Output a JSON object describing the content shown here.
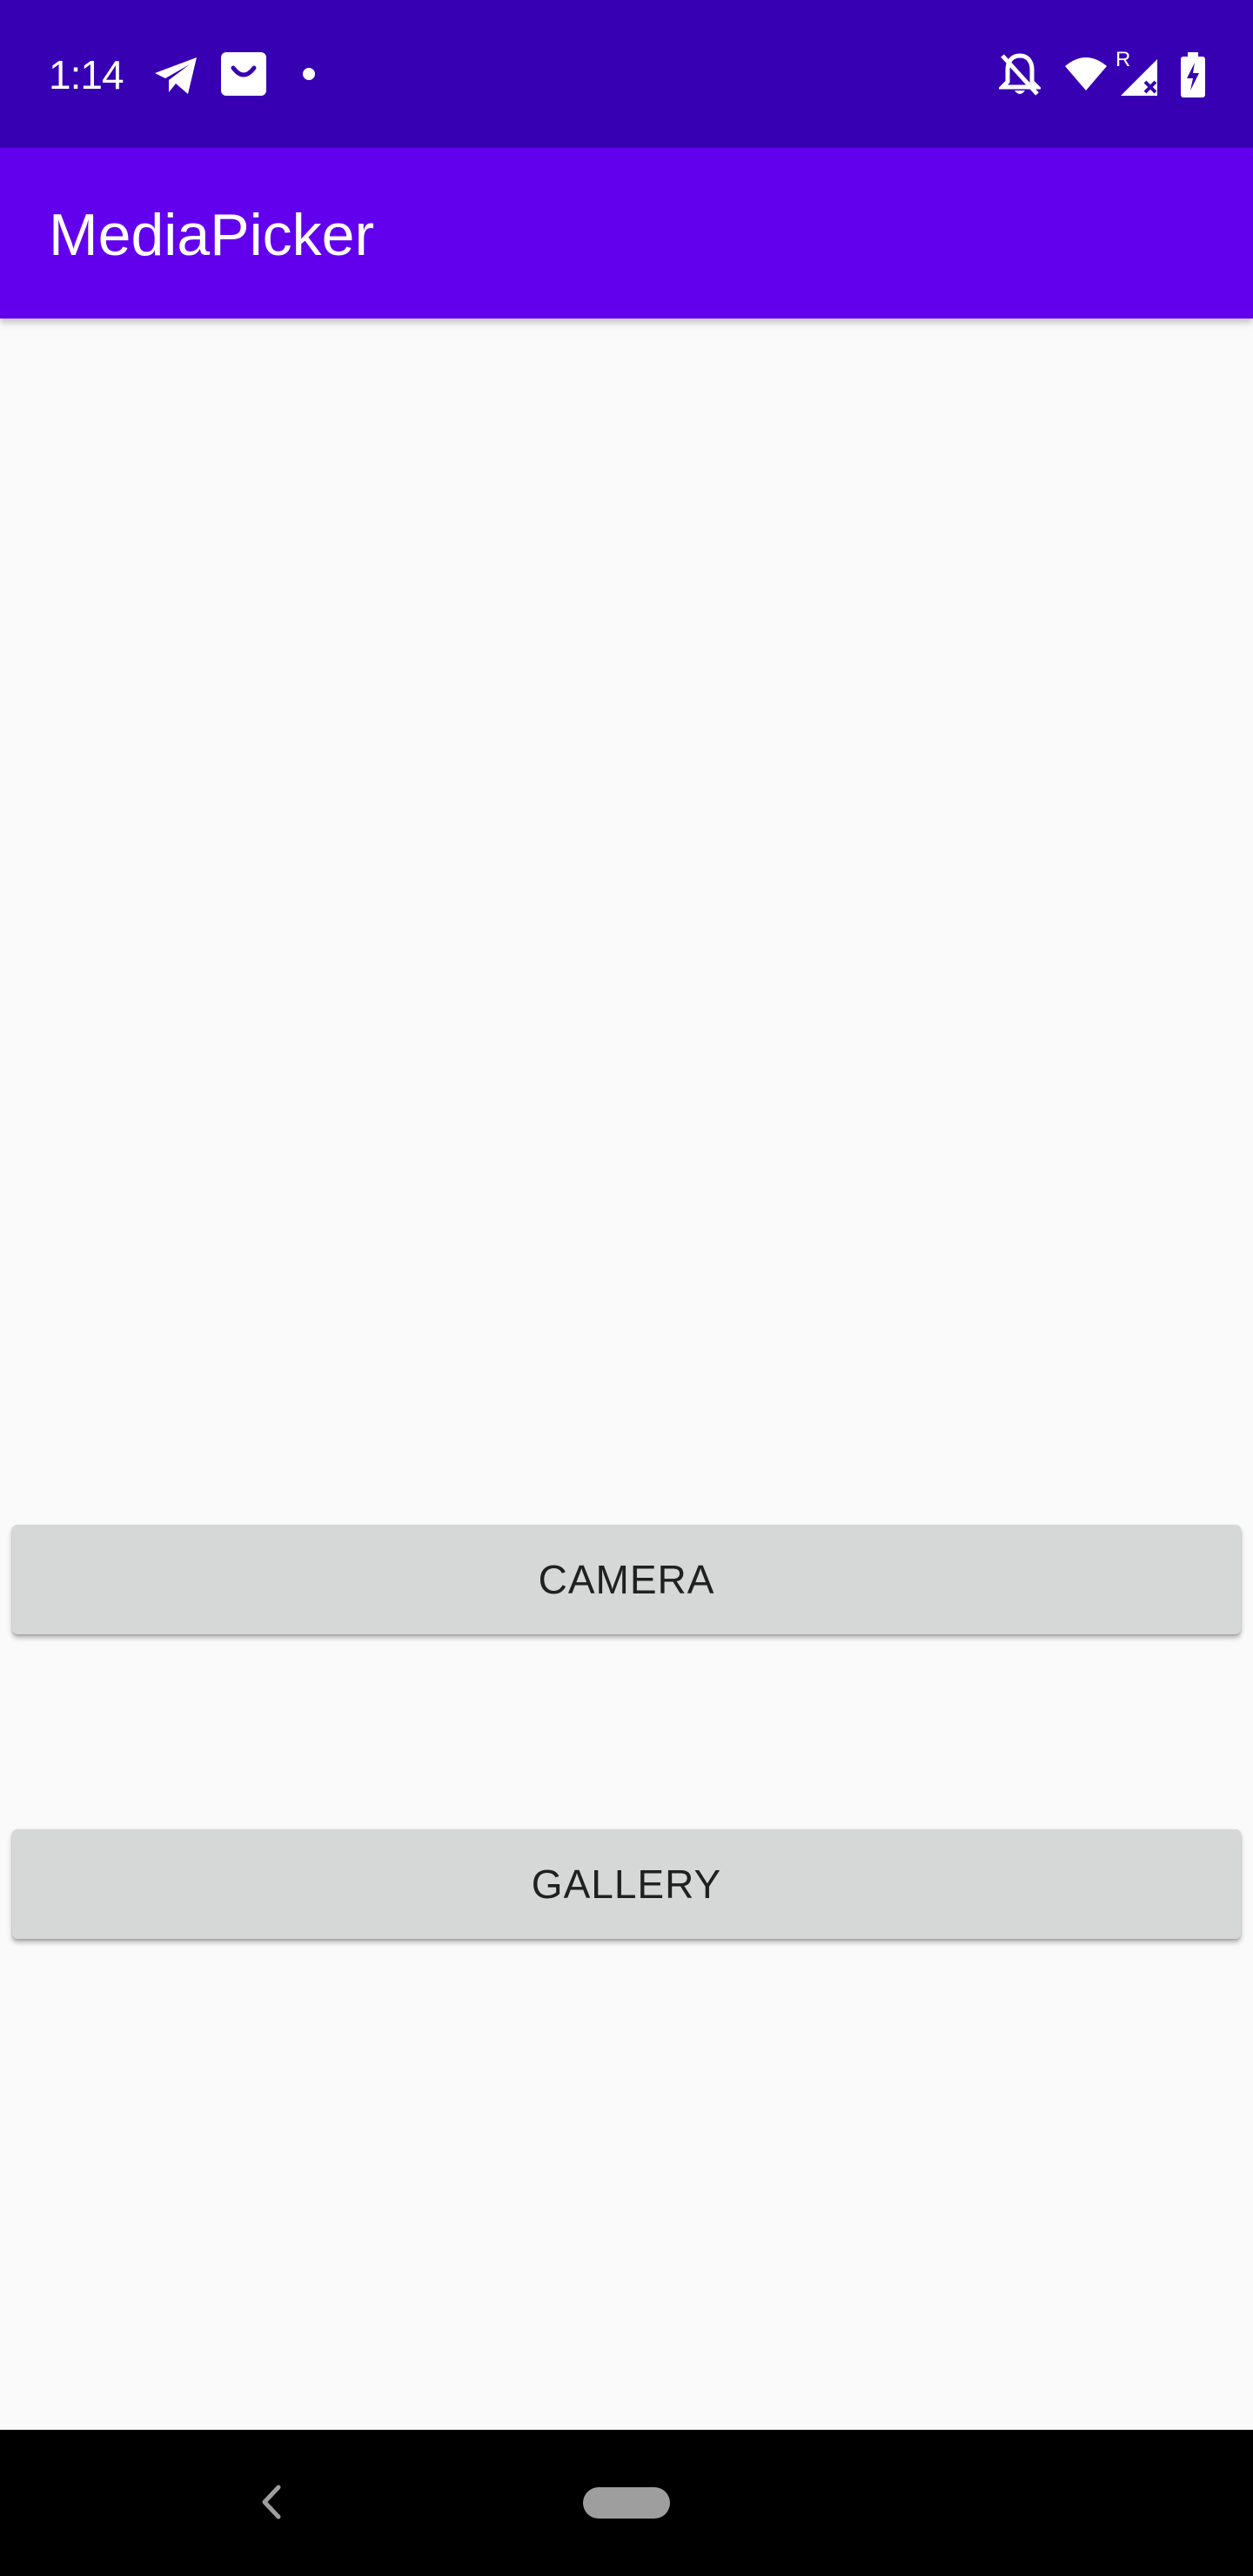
{
  "status_bar": {
    "time": "1:14",
    "icons": [
      "telegram-icon",
      "shopping-bag-icon",
      "notification-dot-icon",
      "bell-off-icon",
      "wifi-icon",
      "signal-roaming-icon",
      "battery-charging-icon"
    ],
    "roaming_label": "R"
  },
  "app_bar": {
    "title": "MediaPicker"
  },
  "buttons": {
    "camera_label": "CAMERA",
    "gallery_label": "GALLERY"
  },
  "nav_bar": {
    "icons": [
      "back-icon",
      "home-pill-icon"
    ]
  },
  "colors": {
    "status_bar": "#3700b3",
    "app_bar": "#6200ee",
    "background": "#fafafa",
    "button": "#d6d7d7",
    "nav_bar": "#000000"
  }
}
